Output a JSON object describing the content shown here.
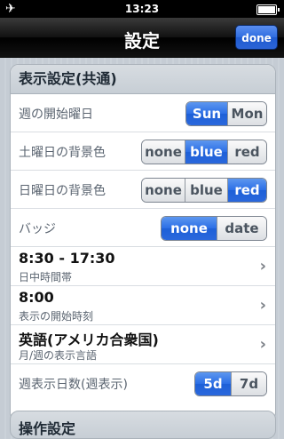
{
  "status_bar": {
    "time": "13:23"
  },
  "nav": {
    "title": "設定",
    "done_label": "done"
  },
  "section1": {
    "header": "表示設定(共通)",
    "week_start": {
      "label": "週の開始曜日",
      "options": [
        "Sun",
        "Mon"
      ],
      "selected": "Sun"
    },
    "saturday_bg": {
      "label": "土曜日の背景色",
      "options": [
        "none",
        "blue",
        "red"
      ],
      "selected": "blue"
    },
    "sunday_bg": {
      "label": "日曜日の背景色",
      "options": [
        "none",
        "blue",
        "red"
      ],
      "selected": "red"
    },
    "badge": {
      "label": "バッジ",
      "options": [
        "none",
        "date"
      ],
      "selected": "none"
    },
    "daytime": {
      "value": "8:30 - 17:30",
      "label": "日中時間帯"
    },
    "start_time": {
      "value": "8:00",
      "label": "表示の開始時刻"
    },
    "language": {
      "value": "英語(アメリカ合衆国)",
      "label": "月/週の表示言語"
    },
    "week_days": {
      "label": "週表示日数(週表示)",
      "options": [
        "5d",
        "7d"
      ],
      "selected": "5d"
    }
  },
  "section2": {
    "header": "操作設定"
  },
  "colors": {
    "accent": "#2b6ee6",
    "nav_bg": "#111111"
  }
}
